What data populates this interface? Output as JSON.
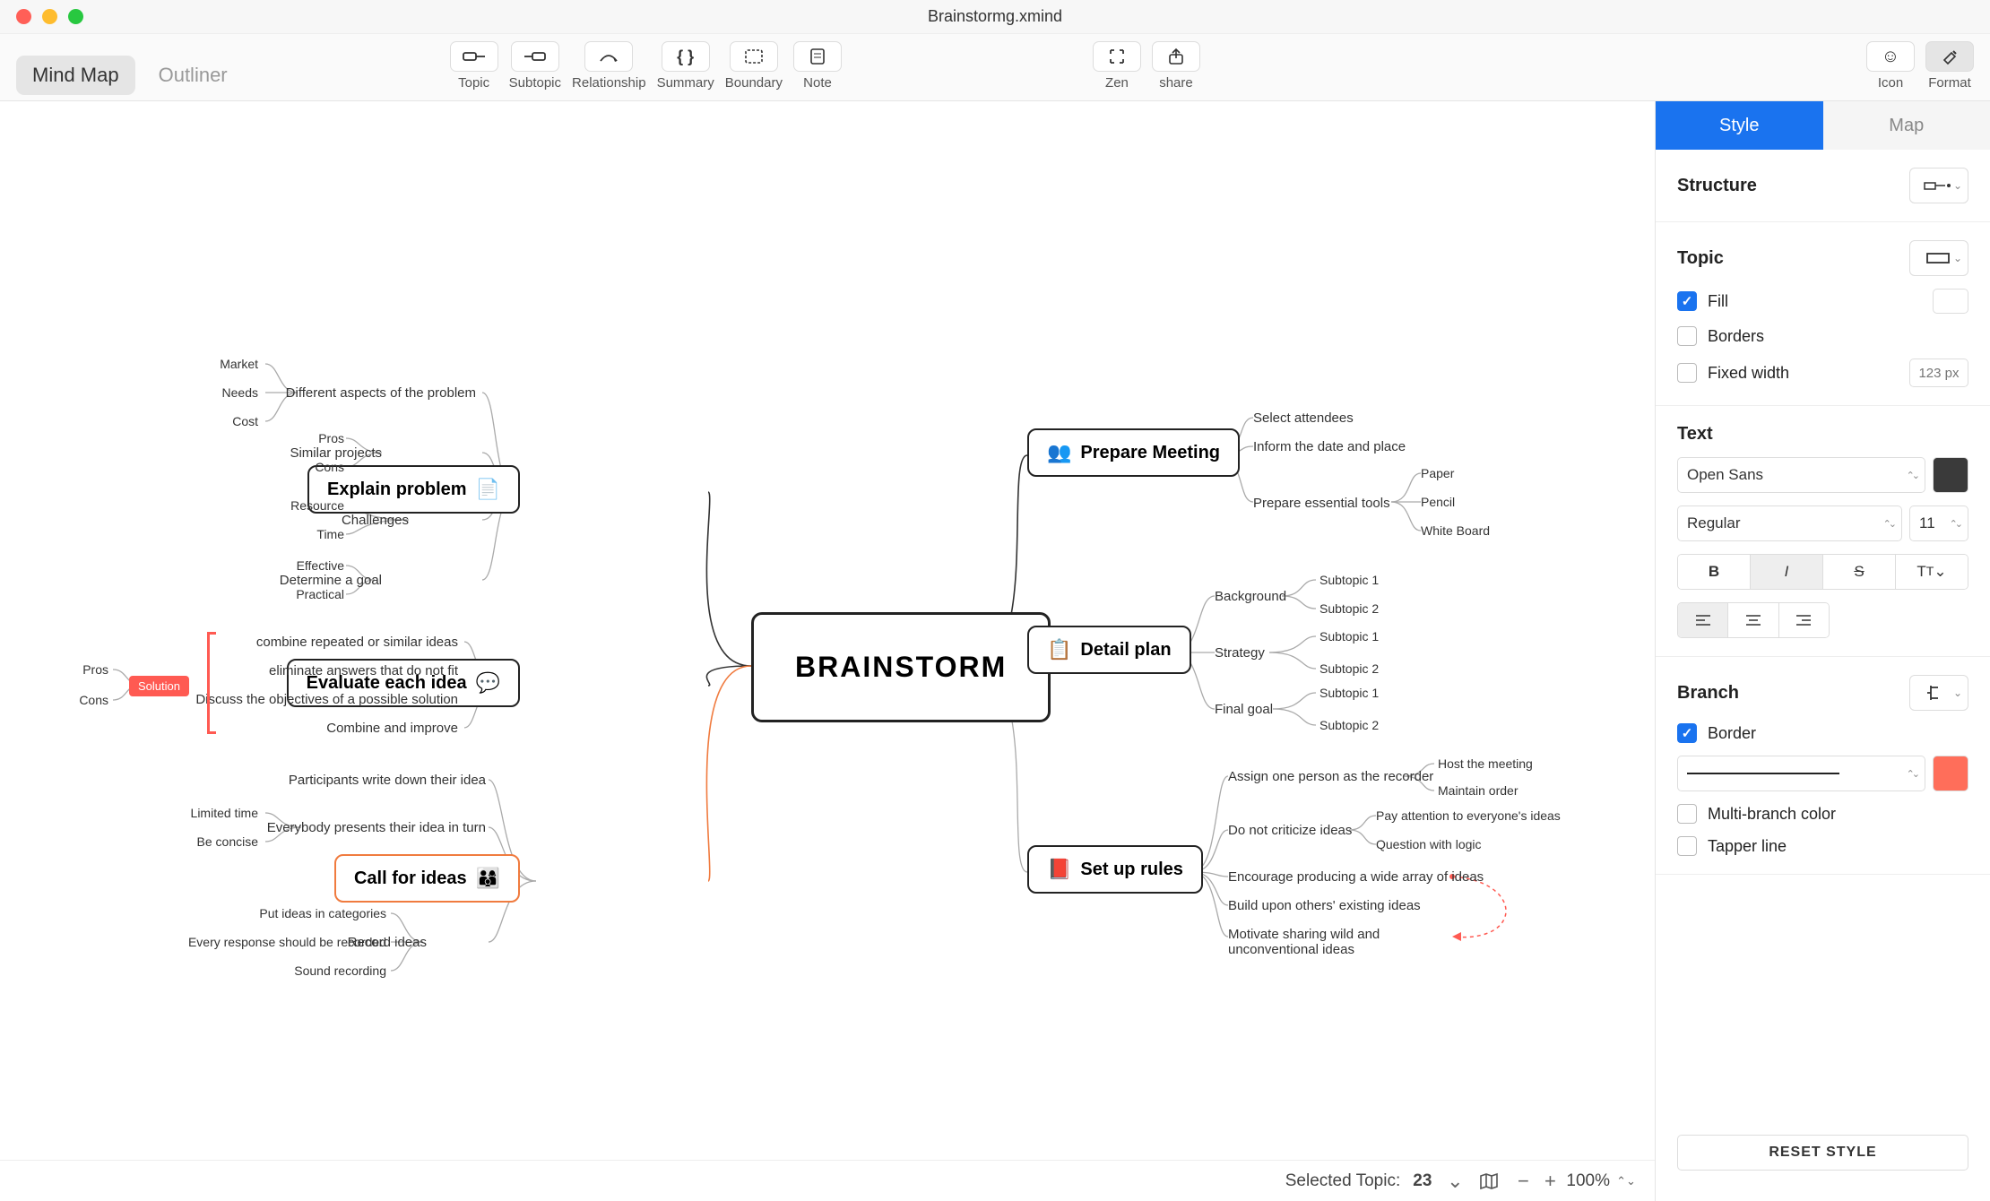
{
  "window_title": "Brainstormg.xmind",
  "view_tabs": {
    "mindmap": "Mind Map",
    "outliner": "Outliner"
  },
  "tools": {
    "topic": "Topic",
    "subtopic": "Subtopic",
    "relationship": "Relationship",
    "summary": "Summary",
    "boundary": "Boundary",
    "note": "Note",
    "zen": "Zen",
    "share": "share",
    "icon": "Icon",
    "format": "Format"
  },
  "side": {
    "tabs": {
      "style": "Style",
      "map": "Map"
    },
    "structure_label": "Structure",
    "topic_label": "Topic",
    "fill": "Fill",
    "borders": "Borders",
    "fixed_width": "Fixed width",
    "fixed_width_placeholder": "123 px",
    "text_label": "Text",
    "font_family": "Open Sans",
    "font_weight": "Regular",
    "font_size": "11",
    "branch_label": "Branch",
    "border_label": "Border",
    "multi_branch": "Multi-branch color",
    "tapper": "Tapper line",
    "reset": "RESET STYLE",
    "border_swatch": "#ff6e5a",
    "text_swatch": "#3a3a3a"
  },
  "status": {
    "selected_label": "Selected Topic:",
    "selected_count": "23",
    "zoom": "100%"
  },
  "map": {
    "center": "BRAINSTORM",
    "left": [
      {
        "label": "Explain problem",
        "children": [
          {
            "label": "Different aspects of the problem",
            "children": [
              "Market",
              "Needs",
              "Cost"
            ]
          },
          {
            "label": "Similar projects",
            "children": [
              "Pros",
              "Cons"
            ]
          },
          {
            "label": "Challenges",
            "children": [
              "Resource",
              "Time"
            ]
          },
          {
            "label": "Determine a goal",
            "children": [
              "Effective",
              "Practical"
            ]
          }
        ]
      },
      {
        "label": "Evaluate each idea",
        "children": [
          {
            "label": "combine repeated or similar ideas"
          },
          {
            "label": "eliminate answers that do not fit"
          },
          {
            "label": "Discuss the objectives of a possible solution"
          },
          {
            "label": "Combine and improve"
          }
        ],
        "solution": {
          "tag": "Solution",
          "children": [
            "Pros",
            "Cons"
          ]
        }
      },
      {
        "label": "Call for ideas",
        "children": [
          {
            "label": "Participants write down their idea"
          },
          {
            "label": "Everybody presents their idea in turn",
            "children": [
              "Limited time",
              "Be concise"
            ]
          },
          {
            "label": "Record ideas",
            "children": [
              "Put ideas in categories",
              "Every response should be recorded",
              "Sound recording"
            ]
          }
        ]
      }
    ],
    "right": [
      {
        "label": "Prepare Meeting",
        "children": [
          {
            "label": "Select attendees"
          },
          {
            "label": "Inform the date and place"
          },
          {
            "label": "Prepare essential tools",
            "children": [
              "Paper",
              "Pencil",
              "White Board"
            ]
          }
        ]
      },
      {
        "label": "Detail plan",
        "children": [
          {
            "label": "Background",
            "children": [
              "Subtopic 1",
              "Subtopic 2"
            ]
          },
          {
            "label": "Strategy",
            "children": [
              "Subtopic 1",
              "Subtopic 2"
            ]
          },
          {
            "label": "Final goal",
            "children": [
              "Subtopic 1",
              "Subtopic 2"
            ]
          }
        ]
      },
      {
        "label": "Set up rules",
        "children": [
          {
            "label": "Assign one person as the recorder",
            "children": [
              "Host the meeting",
              "Maintain order"
            ]
          },
          {
            "label": "Do not criticize ideas",
            "children": [
              "Pay attention to everyone's ideas",
              "Question with logic"
            ]
          },
          {
            "label": "Encourage producing a wide array of ideas"
          },
          {
            "label": "Build upon others' existing ideas"
          },
          {
            "label": "Motivate sharing wild and unconventional ideas"
          }
        ]
      }
    ]
  }
}
